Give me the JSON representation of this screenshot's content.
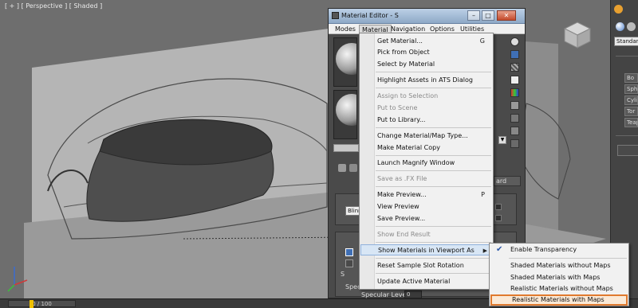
{
  "viewport": {
    "label": "[ + ] [ Perspective ] [ Shaded ]"
  },
  "timeline": {
    "frame_display": "0 / 100"
  },
  "material_editor": {
    "title": "Material Editor - S",
    "menus": [
      "Modes",
      "Material",
      "Navigation",
      "Options",
      "Utilities"
    ],
    "body_texts": {
      "ard": "ard",
      "blinn": "Blinn",
      "specular_level": "Specular Level:",
      "specular_level_value": "0",
      "spec_short": "Spec",
      "s_short": "S"
    }
  },
  "material_menu": {
    "items": [
      {
        "label": "Get Material...",
        "shortcut": "G",
        "disabled": false
      },
      {
        "label": "Pick from Object",
        "disabled": false
      },
      {
        "label": "Select by Material",
        "disabled": false
      },
      {
        "label": "Highlight Assets in ATS Dialog",
        "disabled": false
      },
      {
        "label": "Assign to Selection",
        "disabled": true
      },
      {
        "label": "Put to Scene",
        "disabled": true
      },
      {
        "label": "Put to Library...",
        "disabled": false
      },
      {
        "label": "Change Material/Map Type...",
        "disabled": false
      },
      {
        "label": "Make Material Copy",
        "disabled": false
      },
      {
        "label": "Launch Magnify Window",
        "disabled": false
      },
      {
        "label": "Save as .FX File",
        "disabled": true
      },
      {
        "label": "Make Preview...",
        "shortcut": "P",
        "disabled": false
      },
      {
        "label": "View Preview",
        "disabled": false
      },
      {
        "label": "Save Preview...",
        "disabled": false
      },
      {
        "label": "Show End Result",
        "disabled": true
      },
      {
        "label": "Show Materials in Viewport As",
        "disabled": false,
        "submenu": true
      },
      {
        "label": "Reset Sample Slot Rotation",
        "disabled": false
      },
      {
        "label": "Update Active Material",
        "disabled": false
      }
    ]
  },
  "viewport_submenu": {
    "items": [
      {
        "label": "Enable Transparency",
        "checked": true
      },
      {
        "label": "Shaded Materials without Maps"
      },
      {
        "label": "Shaded Materials with Maps"
      },
      {
        "label": "Realistic Materials without Maps"
      },
      {
        "label": "Realistic Materials with Maps",
        "selected": true
      }
    ]
  },
  "command_panel": {
    "dropdown_value": "Standard",
    "buttons": [
      "Bo",
      "Sphe",
      "Cylin",
      "Tor",
      "Teap"
    ]
  },
  "colors": {
    "selection_outline": "#e07a2e",
    "menu_highlight": "#d8e6f5",
    "titlebar": "#8ea9c7"
  }
}
